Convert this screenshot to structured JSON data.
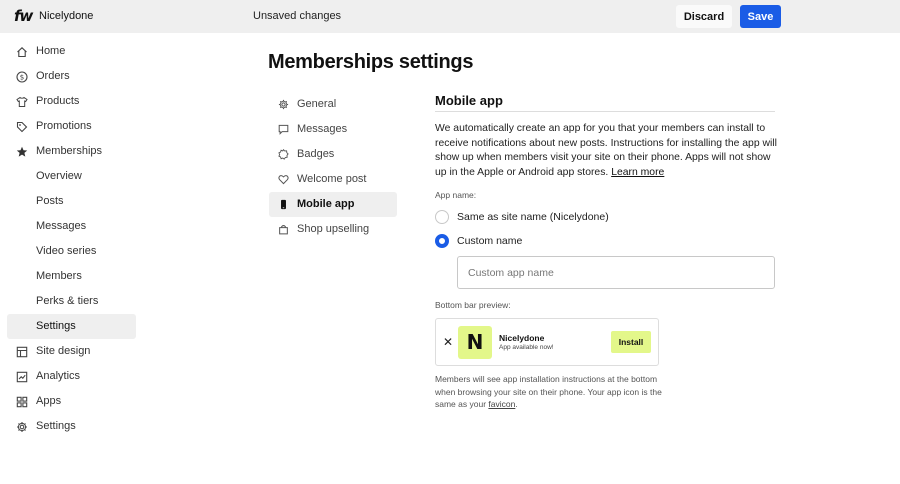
{
  "header": {
    "logo": "fw",
    "site_name": "Nicelydone",
    "status": "Unsaved changes",
    "discard_label": "Discard",
    "save_label": "Save"
  },
  "sidebar": {
    "items": [
      {
        "label": "Home",
        "icon": "home-icon"
      },
      {
        "label": "Orders",
        "icon": "dollar-icon"
      },
      {
        "label": "Products",
        "icon": "shirt-icon"
      },
      {
        "label": "Promotions",
        "icon": "tag-icon"
      },
      {
        "label": "Memberships",
        "icon": "star-icon"
      },
      {
        "label": "Overview"
      },
      {
        "label": "Posts"
      },
      {
        "label": "Messages"
      },
      {
        "label": "Video series"
      },
      {
        "label": "Members"
      },
      {
        "label": "Perks & tiers"
      },
      {
        "label": "Settings",
        "active": true
      },
      {
        "label": "Site design",
        "icon": "layout-icon"
      },
      {
        "label": "Analytics",
        "icon": "chart-icon"
      },
      {
        "label": "Apps",
        "icon": "apps-icon"
      },
      {
        "label": "Settings",
        "icon": "gear-icon"
      }
    ]
  },
  "main": {
    "title": "Memberships settings",
    "subnav": [
      {
        "label": "General",
        "icon": "gear-icon"
      },
      {
        "label": "Messages",
        "icon": "chat-icon"
      },
      {
        "label": "Badges",
        "icon": "badge-icon"
      },
      {
        "label": "Welcome post",
        "icon": "heart-icon"
      },
      {
        "label": "Mobile app",
        "icon": "phone-icon",
        "active": true
      },
      {
        "label": "Shop upselling",
        "icon": "bag-icon"
      }
    ],
    "section": {
      "title": "Mobile app",
      "description": "We automatically create an app for you that your members can install to receive notifications about new posts. Instructions for installing the app will show up when members visit your site on their phone. Apps will not show up in the Apple or Android app stores.",
      "learn_more": "Learn more",
      "app_name_label": "App name:",
      "option_same": "Same as site name (Nicelydone)",
      "option_custom": "Custom name",
      "selected_option": "custom",
      "custom_placeholder": "Custom app name",
      "custom_value": "",
      "preview_label": "Bottom bar preview:",
      "preview": {
        "close": "✕",
        "icon_letter": "N",
        "app_name": "Nicelydone",
        "app_sub": "App available now!",
        "install": "Install"
      },
      "help_text": "Members will see app installation instructions at the bottom when browsing your site on their phone. Your app icon is the same as your",
      "help_link": "favicon",
      "help_end": "."
    }
  },
  "colors": {
    "accent": "#1a5ce6",
    "topbar_bg": "#efefef",
    "preview_bg": "#e3f78a"
  }
}
